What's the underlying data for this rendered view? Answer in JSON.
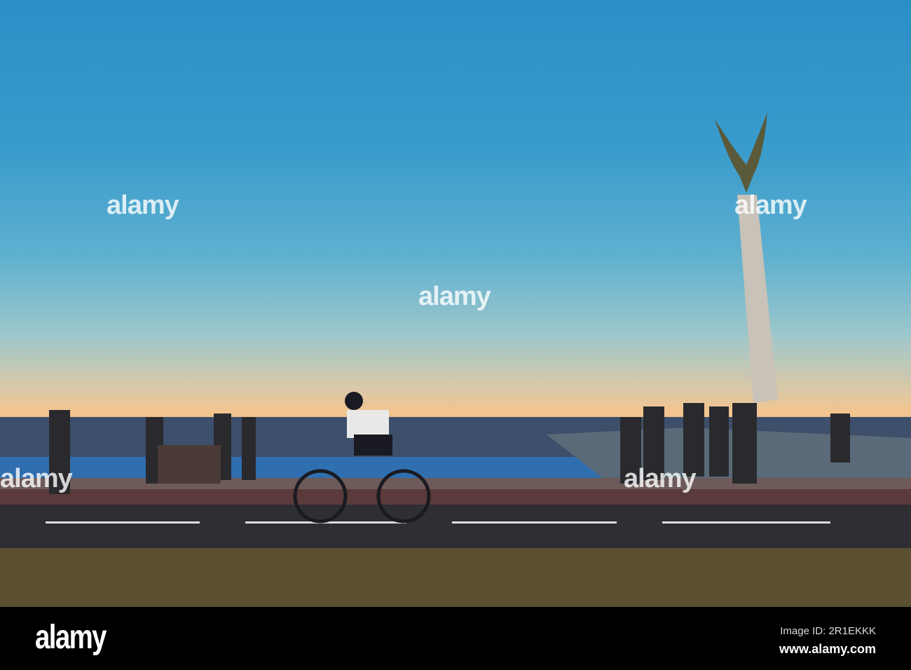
{
  "watermark": "alamy",
  "footer": {
    "logo": "alamy",
    "image_id": "Image ID: 2R1EKKK",
    "url": "www.alamy.com"
  }
}
